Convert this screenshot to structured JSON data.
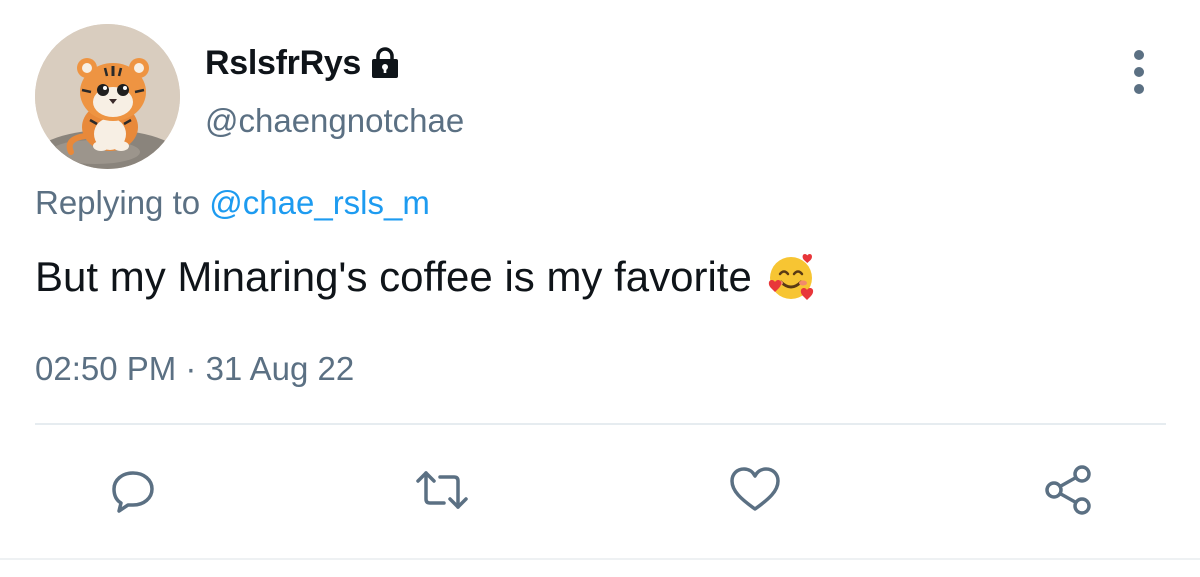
{
  "user": {
    "display_name": "RslsfrRys",
    "handle": "@chaengnotchae",
    "protected": true,
    "avatar": "tiger-cub-illustration"
  },
  "reply": {
    "prefix": "Replying to",
    "target": "@chae_rsls_m"
  },
  "tweet": {
    "text": "But my Minaring's coffee is my favorite",
    "emoji": "smiling-face-with-hearts",
    "timestamp": "02:50 PM · 31 Aug 22"
  },
  "actions": [
    "reply-icon",
    "retweet-icon",
    "like-icon",
    "share-icon"
  ],
  "colors": {
    "text": "#0f1419",
    "secondary": "#5b7083",
    "link": "#1d9bf0",
    "divider": "#e6ecf0"
  }
}
